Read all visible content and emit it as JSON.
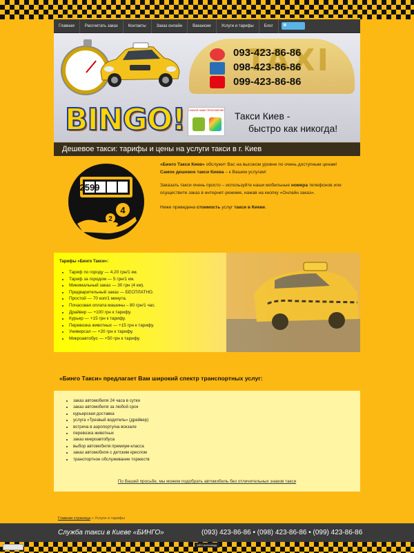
{
  "nav": {
    "items": [
      "Главная",
      "Рассчитать заказ",
      "Контакты",
      "Заказ онлайн",
      "Вакансии",
      "Услуги и тарифы",
      "Блог"
    ],
    "social_label": "в"
  },
  "header": {
    "taxi_sign": "TAXI",
    "phones": [
      "093-423-86-86",
      "098-423-86-86",
      "099-423-86-86"
    ],
    "operators": [
      "life",
      "Київстар",
      "МТС"
    ],
    "logo": "BINGO!",
    "app_label": "СКАЧАЙ НАШЕ ПРИЛОЖЕНИЕ",
    "slogan_line1": "Такси Киев -",
    "slogan_line2": "быстро как никогда!"
  },
  "page_title": "Дешевое такси: тарифы и цены на услуги такси в г. Киев",
  "intro": {
    "counter_digits": "2599",
    "p1_bold1": "«Бинго Такси Киев»",
    "p1_text1": " обслужит Вас на высоком уровне по очень доступным ценам!",
    "p1_bold2": "Самое дешевое такси Киева",
    "p1_text2": " – к Вашим услугам!",
    "p2_text1": "Заказать такси очень просто – используйте наши мобильные ",
    "p2_bold": "номера",
    "p2_text2": " телефонов или осуществите заказ в интернет-режиме, нажав на кнопку «Онлайн заказ».",
    "p3_text1": "Ниже приведена ",
    "p3_bold1": "стоимость",
    "p3_text2": " услуг ",
    "p3_bold2": "такси в Киеве",
    "p3_text3": "."
  },
  "tariffs": {
    "title": "Тарифы «Бинго Такси»:",
    "items": [
      "Тариф по городу — 4.20 грн/1 км.",
      "Тариф за городом — 5 грн/1 км.",
      "Минимальный заказ — 30 грн (4 км).",
      "Предварительный заказ — БЕСПЛАТНО.",
      "Простой — 70 коп/1 минута.",
      "Почасовая оплата машины – 80 грн/1 час.",
      "Драйвер — +100 грн к тарифу.",
      "Курьер — +15 грн к тарифу.",
      "Перевозка животных — +15 грн к тарифу.",
      "Универсал — +20 грн к тарифу.",
      "Микроавтобус — +50 грн к тарифу."
    ]
  },
  "services": {
    "heading": "«Бинго Такси» предлагает Вам широкий спектр транспортных услуг:",
    "items": [
      "заказ автомобиля 24 часа в сутки",
      "заказ автомобиля за любой срок",
      "курьерская доставка",
      "услуга «Трезвый водитель» (драйвер)",
      "встреча в аэропорту/на вокзале",
      "перевозка животных",
      "заказ микроавтобуса",
      "выбор автомобиля премиум-класса",
      "заказ автомобиля с детским креслом",
      "транспортное обслуживание торжеств"
    ],
    "note": "По Вашей просьбе, мы можем подобрать автомобиль без отличительных знаков такси"
  },
  "breadcrumb": {
    "home": "Главная страница",
    "sep": " » ",
    "current": "Услуги и тарифы"
  },
  "footer": {
    "left": "Служба такси в Киеве «БИНГО»",
    "phones": "(093) 423-86-86 • (098) 423-86-86 • (099) 423-86-86",
    "dev": "UEX technology"
  },
  "colors": {
    "background": "#fdb913",
    "nav": "#3a3a3a",
    "title_bar": "#3a2f1a",
    "services_box": "#fff5a3"
  }
}
